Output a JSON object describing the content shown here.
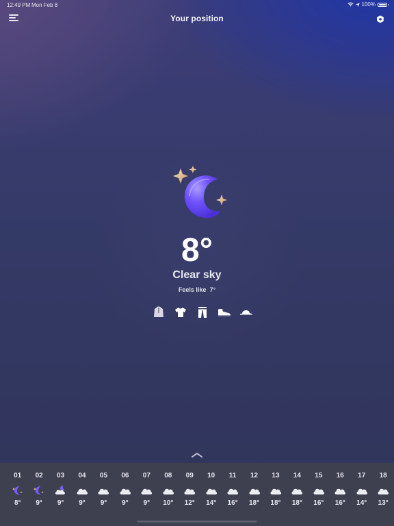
{
  "status_bar": {
    "time": "12:49 PM",
    "date": "Mon Feb 8",
    "battery": "100%"
  },
  "header": {
    "title": "Your position",
    "menu_icon": "hamburger-menu-icon",
    "settings_icon": "hexagon-settings-icon"
  },
  "current": {
    "icon": "crescent-moon-stars-icon",
    "temperature": "8°",
    "condition": "Clear sky",
    "feels_like_label": "Feels like",
    "feels_like_value": "7°",
    "clothing": [
      "hoodie-icon",
      "t-shirt-icon",
      "pants-icon",
      "sneaker-icon",
      "cap-icon"
    ]
  },
  "colors": {
    "accent_moon": "#7a5cff",
    "sparkle": "#e6c49a",
    "panel": "#3e3f4f"
  },
  "hourly": [
    {
      "hour": "01",
      "icon": "moon-icon",
      "temp": "8°"
    },
    {
      "hour": "02",
      "icon": "moon-icon",
      "temp": "9°"
    },
    {
      "hour": "03",
      "icon": "moon-cloud-icon",
      "temp": "9°"
    },
    {
      "hour": "04",
      "icon": "cloud-icon",
      "temp": "9°"
    },
    {
      "hour": "05",
      "icon": "cloud-icon",
      "temp": "9°"
    },
    {
      "hour": "06",
      "icon": "cloud-icon",
      "temp": "9°"
    },
    {
      "hour": "07",
      "icon": "cloud-icon",
      "temp": "9°"
    },
    {
      "hour": "08",
      "icon": "cloud-icon",
      "temp": "10°"
    },
    {
      "hour": "09",
      "icon": "cloud-icon",
      "temp": "12°"
    },
    {
      "hour": "10",
      "icon": "cloud-icon",
      "temp": "14°"
    },
    {
      "hour": "11",
      "icon": "cloud-icon",
      "temp": "16°"
    },
    {
      "hour": "12",
      "icon": "cloud-icon",
      "temp": "18°"
    },
    {
      "hour": "13",
      "icon": "cloud-icon",
      "temp": "18°"
    },
    {
      "hour": "14",
      "icon": "cloud-icon",
      "temp": "18°"
    },
    {
      "hour": "15",
      "icon": "cloud-icon",
      "temp": "16°"
    },
    {
      "hour": "16",
      "icon": "cloud-icon",
      "temp": "16°"
    },
    {
      "hour": "17",
      "icon": "cloud-icon",
      "temp": "14°"
    },
    {
      "hour": "18",
      "icon": "cloud-icon",
      "temp": "13°"
    }
  ]
}
